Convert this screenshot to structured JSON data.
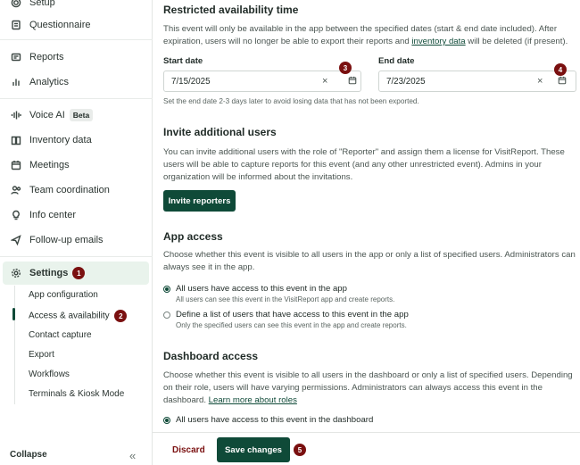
{
  "sidebar": {
    "items": [
      {
        "label": "Setup",
        "icon": "gear-outline-icon"
      },
      {
        "label": "Questionnaire",
        "icon": "document-icon"
      },
      {
        "label": "Reports",
        "icon": "report-icon"
      },
      {
        "label": "Analytics",
        "icon": "bar-chart-icon"
      },
      {
        "label": "Voice AI",
        "icon": "waveform-icon",
        "badge": "Beta"
      },
      {
        "label": "Inventory data",
        "icon": "book-icon"
      },
      {
        "label": "Meetings",
        "icon": "calendar-icon"
      },
      {
        "label": "Team coordination",
        "icon": "team-icon"
      },
      {
        "label": "Info center",
        "icon": "lightbulb-icon"
      },
      {
        "label": "Follow-up emails",
        "icon": "send-icon"
      },
      {
        "label": "Settings",
        "icon": "settings-icon",
        "step": "1"
      }
    ],
    "subitems": [
      {
        "label": "App configuration"
      },
      {
        "label": "Access & availability",
        "step": "2"
      },
      {
        "label": "Contact capture"
      },
      {
        "label": "Export"
      },
      {
        "label": "Workflows"
      },
      {
        "label": "Terminals & Kiosk Mode"
      }
    ],
    "collapse_label": "Collapse",
    "collapse_icon": "«"
  },
  "availability": {
    "title": "Restricted availability time",
    "desc_part1": "This event will only be available in the app between the specified dates (start & end date included). After expiration, users will no longer be able to export their reports and ",
    "desc_link": "inventory data",
    "desc_part2": " will be deleted (if present).",
    "start_label": "Start date",
    "start_value": "7/15/2025",
    "start_step": "3",
    "end_label": "End date",
    "end_value": "7/23/2025",
    "end_step": "4",
    "clear_icon": "×",
    "hint": "Set the end date 2-3 days later to avoid losing data that has not been exported."
  },
  "invite": {
    "title": "Invite additional users",
    "desc": "You can invite additional users with the role of \"Reporter\" and assign them a license for VisitReport. These users will be able to capture reports for this event (and any other unrestricted event). Admins in your organization will be informed about the invitations.",
    "button": "Invite reporters"
  },
  "app_access": {
    "title": "App access",
    "desc": "Choose whether this event is visible to all users in the app or only a list of specified users. Administrators can always see it in the app.",
    "options": [
      {
        "label": "All users have access to this event in the app",
        "sub": "All users can see this event in the VisitReport app and create reports.",
        "selected": true
      },
      {
        "label": "Define a list of users that have access to this event in the app",
        "sub": "Only the specified users can see this event in the app and create reports.",
        "selected": false
      }
    ]
  },
  "dashboard_access": {
    "title": "Dashboard access",
    "desc_part1": "Choose whether this event is visible to all users in the dashboard or only a list of specified users. Depending on their role, users will have varying permissions. Administrators can always access this event in the dashboard. ",
    "desc_link": "Learn more about roles",
    "option": "All users have access to this event in the dashboard"
  },
  "footer": {
    "discard": "Discard",
    "save": "Save changes",
    "save_step": "5"
  },
  "colors": {
    "primary": "#0f4a38",
    "step_badge": "#7a1010",
    "active_bg": "#e9f3ec"
  }
}
